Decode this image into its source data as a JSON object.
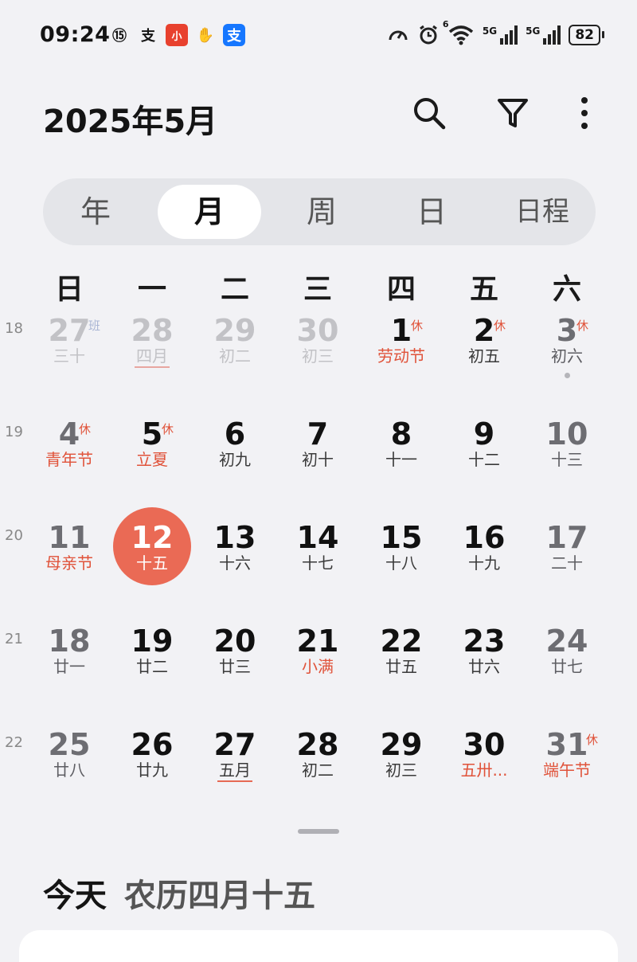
{
  "status_bar": {
    "time": "09:24",
    "left_icons": [
      "data-saver-icon",
      "alipay-icon",
      "app-ai-icon",
      "hand-icon",
      "alipay-blue-icon"
    ],
    "left_icon_glyphs": [
      "⑮",
      "支",
      "小",
      "✋",
      "支"
    ],
    "right_icons": [
      "speedometer-icon",
      "alarm-icon",
      "wifi-icon",
      "5g-signal-icon",
      "5g-signal-icon"
    ],
    "wifi_badge": "6",
    "signal_label_1": "5G",
    "signal_label_2": "5G",
    "battery": "82"
  },
  "header": {
    "title": "2025年5月",
    "icons": [
      "search-icon",
      "filter-icon",
      "more-icon"
    ]
  },
  "view_tabs": [
    {
      "label": "年",
      "active": false
    },
    {
      "label": "月",
      "active": true
    },
    {
      "label": "周",
      "active": false
    },
    {
      "label": "日",
      "active": false
    },
    {
      "label": "日程",
      "active": false
    }
  ],
  "weekdays": [
    "日",
    "一",
    "二",
    "三",
    "四",
    "五",
    "六"
  ],
  "week_numbers": [
    "18",
    "19",
    "20",
    "21",
    "22"
  ],
  "weeks": [
    [
      {
        "day": "27",
        "lunar": "三十",
        "other": true,
        "badge": "班",
        "badge_type": "ban"
      },
      {
        "day": "28",
        "lunar": "四月",
        "other": true,
        "underline": "faint"
      },
      {
        "day": "29",
        "lunar": "初二",
        "other": true
      },
      {
        "day": "30",
        "lunar": "初三",
        "other": true
      },
      {
        "day": "1",
        "lunar": "劳动节",
        "festival": true,
        "badge": "休"
      },
      {
        "day": "2",
        "lunar": "初五",
        "badge": "休"
      },
      {
        "day": "3",
        "lunar": "初六",
        "badge": "休",
        "weekend": true,
        "dot": true
      }
    ],
    [
      {
        "day": "4",
        "lunar": "青年节",
        "festival": true,
        "badge": "休",
        "weekend": true
      },
      {
        "day": "5",
        "lunar": "立夏",
        "festival": true,
        "badge": "休"
      },
      {
        "day": "6",
        "lunar": "初九"
      },
      {
        "day": "7",
        "lunar": "初十"
      },
      {
        "day": "8",
        "lunar": "十一"
      },
      {
        "day": "9",
        "lunar": "十二"
      },
      {
        "day": "10",
        "lunar": "十三",
        "weekend": true
      }
    ],
    [
      {
        "day": "11",
        "lunar": "母亲节",
        "festival": true,
        "weekend": true
      },
      {
        "day": "12",
        "lunar": "十五",
        "today": true
      },
      {
        "day": "13",
        "lunar": "十六"
      },
      {
        "day": "14",
        "lunar": "十七"
      },
      {
        "day": "15",
        "lunar": "十八"
      },
      {
        "day": "16",
        "lunar": "十九"
      },
      {
        "day": "17",
        "lunar": "二十",
        "weekend": true
      }
    ],
    [
      {
        "day": "18",
        "lunar": "廿一",
        "weekend": true
      },
      {
        "day": "19",
        "lunar": "廿二"
      },
      {
        "day": "20",
        "lunar": "廿三"
      },
      {
        "day": "21",
        "lunar": "小满",
        "festival": true
      },
      {
        "day": "22",
        "lunar": "廿五"
      },
      {
        "day": "23",
        "lunar": "廿六"
      },
      {
        "day": "24",
        "lunar": "廿七",
        "weekend": true
      }
    ],
    [
      {
        "day": "25",
        "lunar": "廿八",
        "weekend": true
      },
      {
        "day": "26",
        "lunar": "廿九"
      },
      {
        "day": "27",
        "lunar": "五月",
        "underline": "solid"
      },
      {
        "day": "28",
        "lunar": "初二"
      },
      {
        "day": "29",
        "lunar": "初三"
      },
      {
        "day": "30",
        "lunar": "五卅...",
        "festival": true
      },
      {
        "day": "31",
        "lunar": "端午节",
        "festival": true,
        "badge": "休",
        "weekend": true
      }
    ]
  ],
  "today_section": {
    "label": "今天",
    "lunar_date": "农历四月十五"
  },
  "colors": {
    "accent": "#ea6a55",
    "festival": "#e0533a",
    "background": "#f2f2f5"
  }
}
